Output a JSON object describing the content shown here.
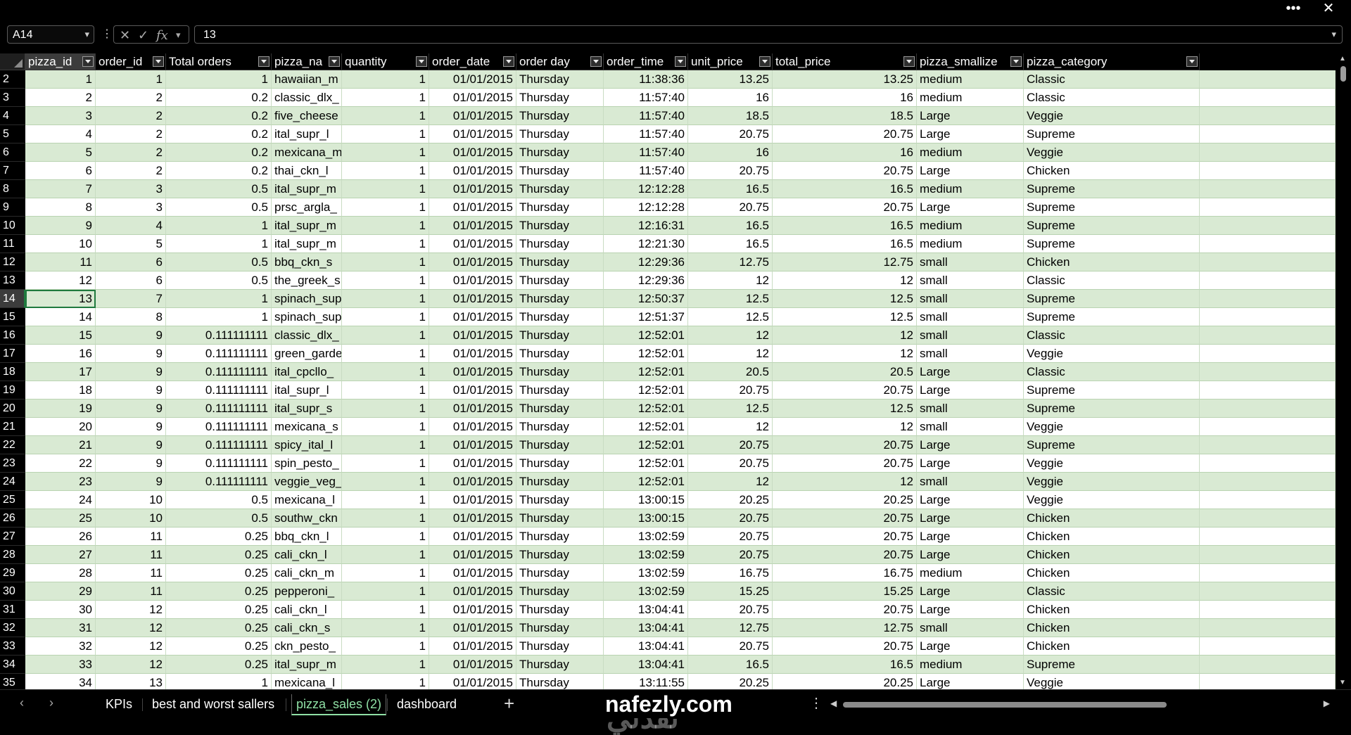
{
  "window": {
    "more_label": "•••",
    "close_label": "✕"
  },
  "formula_bar": {
    "name_box": "A14",
    "formula": "13"
  },
  "columns": [
    {
      "key": "A",
      "label": "pizza_id",
      "align": "num"
    },
    {
      "key": "B",
      "label": "order_id",
      "align": "num"
    },
    {
      "key": "C",
      "label": "Total orders",
      "align": "num"
    },
    {
      "key": "D",
      "label": "pizza_na",
      "align": "txt"
    },
    {
      "key": "E",
      "label": "quantity",
      "align": "num"
    },
    {
      "key": "F",
      "label": "order_date",
      "align": "num"
    },
    {
      "key": "G",
      "label": "order day",
      "align": "txt"
    },
    {
      "key": "H",
      "label": "order_time",
      "align": "num"
    },
    {
      "key": "I",
      "label": "unit_price",
      "align": "num"
    },
    {
      "key": "J",
      "label": "total_price",
      "align": "num"
    },
    {
      "key": "K",
      "label": "pizza_smallize",
      "align": "txt"
    },
    {
      "key": "L",
      "label": "pizza_category",
      "align": "txt"
    }
  ],
  "rows": [
    {
      "n": "2",
      "v": [
        "1",
        "1",
        "1",
        "hawaiian_m",
        "1",
        "01/01/2015",
        "Thursday",
        "11:38:36",
        "13.25",
        "13.25",
        "medium",
        "Classic"
      ]
    },
    {
      "n": "3",
      "v": [
        "2",
        "2",
        "0.2",
        "classic_dlx_",
        "1",
        "01/01/2015",
        "Thursday",
        "11:57:40",
        "16",
        "16",
        "medium",
        "Classic"
      ]
    },
    {
      "n": "4",
      "v": [
        "3",
        "2",
        "0.2",
        "five_cheese",
        "1",
        "01/01/2015",
        "Thursday",
        "11:57:40",
        "18.5",
        "18.5",
        "Large",
        "Veggie"
      ]
    },
    {
      "n": "5",
      "v": [
        "4",
        "2",
        "0.2",
        "ital_supr_l",
        "1",
        "01/01/2015",
        "Thursday",
        "11:57:40",
        "20.75",
        "20.75",
        "Large",
        "Supreme"
      ]
    },
    {
      "n": "6",
      "v": [
        "5",
        "2",
        "0.2",
        "mexicana_m",
        "1",
        "01/01/2015",
        "Thursday",
        "11:57:40",
        "16",
        "16",
        "medium",
        "Veggie"
      ]
    },
    {
      "n": "7",
      "v": [
        "6",
        "2",
        "0.2",
        "thai_ckn_l",
        "1",
        "01/01/2015",
        "Thursday",
        "11:57:40",
        "20.75",
        "20.75",
        "Large",
        "Chicken"
      ]
    },
    {
      "n": "8",
      "v": [
        "7",
        "3",
        "0.5",
        "ital_supr_m",
        "1",
        "01/01/2015",
        "Thursday",
        "12:12:28",
        "16.5",
        "16.5",
        "medium",
        "Supreme"
      ]
    },
    {
      "n": "9",
      "v": [
        "8",
        "3",
        "0.5",
        "prsc_argla_",
        "1",
        "01/01/2015",
        "Thursday",
        "12:12:28",
        "20.75",
        "20.75",
        "Large",
        "Supreme"
      ]
    },
    {
      "n": "10",
      "v": [
        "9",
        "4",
        "1",
        "ital_supr_m",
        "1",
        "01/01/2015",
        "Thursday",
        "12:16:31",
        "16.5",
        "16.5",
        "medium",
        "Supreme"
      ]
    },
    {
      "n": "11",
      "v": [
        "10",
        "5",
        "1",
        "ital_supr_m",
        "1",
        "01/01/2015",
        "Thursday",
        "12:21:30",
        "16.5",
        "16.5",
        "medium",
        "Supreme"
      ]
    },
    {
      "n": "12",
      "v": [
        "11",
        "6",
        "0.5",
        "bbq_ckn_s",
        "1",
        "01/01/2015",
        "Thursday",
        "12:29:36",
        "12.75",
        "12.75",
        "small",
        "Chicken"
      ]
    },
    {
      "n": "13",
      "v": [
        "12",
        "6",
        "0.5",
        "the_greek_s",
        "1",
        "01/01/2015",
        "Thursday",
        "12:29:36",
        "12",
        "12",
        "small",
        "Classic"
      ]
    },
    {
      "n": "14",
      "v": [
        "13",
        "7",
        "1",
        "spinach_sup",
        "1",
        "01/01/2015",
        "Thursday",
        "12:50:37",
        "12.5",
        "12.5",
        "small",
        "Supreme"
      ]
    },
    {
      "n": "15",
      "v": [
        "14",
        "8",
        "1",
        "spinach_sup",
        "1",
        "01/01/2015",
        "Thursday",
        "12:51:37",
        "12.5",
        "12.5",
        "small",
        "Supreme"
      ]
    },
    {
      "n": "16",
      "v": [
        "15",
        "9",
        "0.111111111",
        "classic_dlx_",
        "1",
        "01/01/2015",
        "Thursday",
        "12:52:01",
        "12",
        "12",
        "small",
        "Classic"
      ]
    },
    {
      "n": "17",
      "v": [
        "16",
        "9",
        "0.111111111",
        "green_garde",
        "1",
        "01/01/2015",
        "Thursday",
        "12:52:01",
        "12",
        "12",
        "small",
        "Veggie"
      ]
    },
    {
      "n": "18",
      "v": [
        "17",
        "9",
        "0.111111111",
        "ital_cpcllo_",
        "1",
        "01/01/2015",
        "Thursday",
        "12:52:01",
        "20.5",
        "20.5",
        "Large",
        "Classic"
      ]
    },
    {
      "n": "19",
      "v": [
        "18",
        "9",
        "0.111111111",
        "ital_supr_l",
        "1",
        "01/01/2015",
        "Thursday",
        "12:52:01",
        "20.75",
        "20.75",
        "Large",
        "Supreme"
      ]
    },
    {
      "n": "20",
      "v": [
        "19",
        "9",
        "0.111111111",
        "ital_supr_s",
        "1",
        "01/01/2015",
        "Thursday",
        "12:52:01",
        "12.5",
        "12.5",
        "small",
        "Supreme"
      ]
    },
    {
      "n": "21",
      "v": [
        "20",
        "9",
        "0.111111111",
        "mexicana_s",
        "1",
        "01/01/2015",
        "Thursday",
        "12:52:01",
        "12",
        "12",
        "small",
        "Veggie"
      ]
    },
    {
      "n": "22",
      "v": [
        "21",
        "9",
        "0.111111111",
        "spicy_ital_l",
        "1",
        "01/01/2015",
        "Thursday",
        "12:52:01",
        "20.75",
        "20.75",
        "Large",
        "Supreme"
      ]
    },
    {
      "n": "23",
      "v": [
        "22",
        "9",
        "0.111111111",
        "spin_pesto_",
        "1",
        "01/01/2015",
        "Thursday",
        "12:52:01",
        "20.75",
        "20.75",
        "Large",
        "Veggie"
      ]
    },
    {
      "n": "24",
      "v": [
        "23",
        "9",
        "0.111111111",
        "veggie_veg_",
        "1",
        "01/01/2015",
        "Thursday",
        "12:52:01",
        "12",
        "12",
        "small",
        "Veggie"
      ]
    },
    {
      "n": "25",
      "v": [
        "24",
        "10",
        "0.5",
        "mexicana_l",
        "1",
        "01/01/2015",
        "Thursday",
        "13:00:15",
        "20.25",
        "20.25",
        "Large",
        "Veggie"
      ]
    },
    {
      "n": "26",
      "v": [
        "25",
        "10",
        "0.5",
        "southw_ckn",
        "1",
        "01/01/2015",
        "Thursday",
        "13:00:15",
        "20.75",
        "20.75",
        "Large",
        "Chicken"
      ]
    },
    {
      "n": "27",
      "v": [
        "26",
        "11",
        "0.25",
        "bbq_ckn_l",
        "1",
        "01/01/2015",
        "Thursday",
        "13:02:59",
        "20.75",
        "20.75",
        "Large",
        "Chicken"
      ]
    },
    {
      "n": "28",
      "v": [
        "27",
        "11",
        "0.25",
        "cali_ckn_l",
        "1",
        "01/01/2015",
        "Thursday",
        "13:02:59",
        "20.75",
        "20.75",
        "Large",
        "Chicken"
      ]
    },
    {
      "n": "29",
      "v": [
        "28",
        "11",
        "0.25",
        "cali_ckn_m",
        "1",
        "01/01/2015",
        "Thursday",
        "13:02:59",
        "16.75",
        "16.75",
        "medium",
        "Chicken"
      ]
    },
    {
      "n": "30",
      "v": [
        "29",
        "11",
        "0.25",
        "pepperoni_",
        "1",
        "01/01/2015",
        "Thursday",
        "13:02:59",
        "15.25",
        "15.25",
        "Large",
        "Classic"
      ]
    },
    {
      "n": "31",
      "v": [
        "30",
        "12",
        "0.25",
        "cali_ckn_l",
        "1",
        "01/01/2015",
        "Thursday",
        "13:04:41",
        "20.75",
        "20.75",
        "Large",
        "Chicken"
      ]
    },
    {
      "n": "32",
      "v": [
        "31",
        "12",
        "0.25",
        "cali_ckn_s",
        "1",
        "01/01/2015",
        "Thursday",
        "13:04:41",
        "12.75",
        "12.75",
        "small",
        "Chicken"
      ]
    },
    {
      "n": "33",
      "v": [
        "32",
        "12",
        "0.25",
        "ckn_pesto_",
        "1",
        "01/01/2015",
        "Thursday",
        "13:04:41",
        "20.75",
        "20.75",
        "Large",
        "Chicken"
      ]
    },
    {
      "n": "34",
      "v": [
        "33",
        "12",
        "0.25",
        "ital_supr_m",
        "1",
        "01/01/2015",
        "Thursday",
        "13:04:41",
        "16.5",
        "16.5",
        "medium",
        "Supreme"
      ]
    },
    {
      "n": "35",
      "v": [
        "34",
        "13",
        "1",
        "mexicana_l",
        "1",
        "01/01/2015",
        "Thursday",
        "13:11:55",
        "20.25",
        "20.25",
        "Large",
        "Veggie"
      ]
    }
  ],
  "selected": {
    "row": "14",
    "col": "A"
  },
  "sheet_tabs": [
    {
      "label": "KPIs",
      "active": false
    },
    {
      "label": "best and worst sallers",
      "active": false
    },
    {
      "label": "pizza_sales (2)",
      "active": true
    },
    {
      "label": "dashboard",
      "active": false
    }
  ],
  "tabbar": {
    "prev_label": "‹",
    "next_label": "›",
    "add_label": "+",
    "options_label": "⋮",
    "logo_text": "nafezly.com"
  },
  "watermark": "نفذلي",
  "colors": {
    "even_row": "#d9ead3",
    "odd_row": "#ffffff",
    "accent": "#1f7a3e",
    "active_tab": "#8fe0a5"
  }
}
